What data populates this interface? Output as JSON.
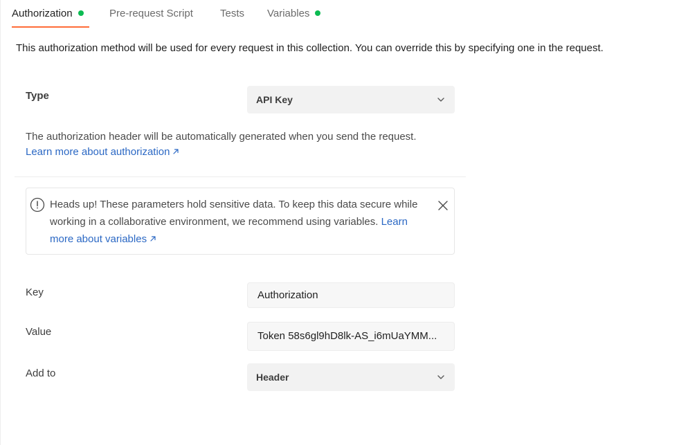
{
  "tabs": [
    {
      "label": "Authorization",
      "active": true,
      "dot": true
    },
    {
      "label": "Pre-request Script",
      "active": false,
      "dot": false
    },
    {
      "label": "Tests",
      "active": false,
      "dot": false
    },
    {
      "label": "Variables",
      "active": false,
      "dot": true
    }
  ],
  "colors": {
    "dot": "#0cbb52",
    "accent": "#ff6c37",
    "link": "#2b68c4"
  },
  "description": "This authorization method will be used for every request in this collection. You can override this by specifying one in the request.",
  "type": {
    "label": "Type",
    "value": "API Key"
  },
  "auth_info": {
    "text": "The authorization header will be automatically generated when you send the request.",
    "link": "Learn more about authorization"
  },
  "alert": {
    "text": "Heads up! These parameters hold sensitive data. To keep this data secure while working in a collaborative environment, we recommend using variables.",
    "link": "Learn more about variables"
  },
  "fields": {
    "key_label": "Key",
    "key_value": "Authorization",
    "value_label": "Value",
    "value_value": "Token 58s6gl9hD8lk-AS_i6mUaYMM...",
    "add_to_label": "Add to",
    "add_to_value": "Header"
  },
  "icons": {
    "chevron": "chevron-down-icon",
    "external": "arrow-up-right-icon",
    "alert": "exclamation-circle-icon",
    "close": "close-icon"
  }
}
